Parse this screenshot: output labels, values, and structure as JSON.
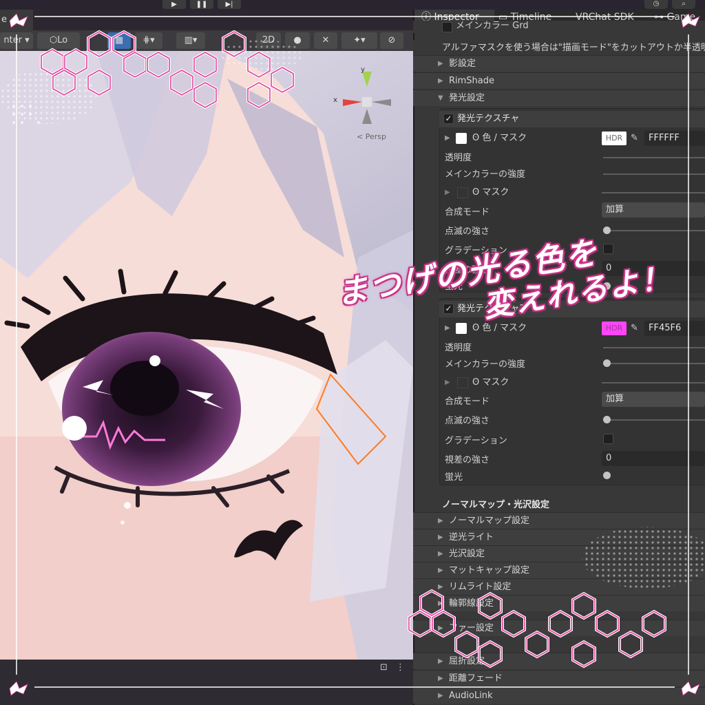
{
  "playbar": {
    "play_icon": "play-icon",
    "pause_icon": "pause-icon",
    "step_icon": "step-icon",
    "history_icon": "history-icon",
    "search_icon": "search-icon"
  },
  "scene": {
    "tab_label": "e",
    "toolbar": {
      "pivot_label": "nter",
      "local_label": "Lo",
      "mode_2d": "2D"
    },
    "gizmo": {
      "y_label": "y",
      "x_label": "x",
      "persp_label": "< Persp"
    }
  },
  "inspector": {
    "tabs": [
      "Inspector",
      "Timeline",
      "VRChat SDK",
      "Game"
    ],
    "top_cut_label": "メインカラー Grd",
    "alpha_note": "アルファマスクを使う場合は\"描画モード\"をカットアウトか半透明に変更",
    "foldouts_top": [
      "影設定",
      "RimShade",
      "発光設定"
    ],
    "emission1": {
      "title": "発光テクスチャ",
      "color_label": "色 / マスク",
      "hdr": "HDR",
      "hex": "FFFFFF",
      "props": [
        "透明度",
        "メインカラーの強度"
      ],
      "mask_label": "マスク",
      "blend_label": "合成モード",
      "blend_value": "加算",
      "blink_label": "点滅の強さ",
      "gradient_label": "グラデーション",
      "parallax_label": "視差の強さ",
      "parallax_value": "0",
      "fluor_label": "蛍光"
    },
    "emission2": {
      "title": "発光テクスチャ2",
      "color_label": "色 / マスク",
      "hdr": "HDR",
      "hex": "FF45F6",
      "props": [
        "透明度",
        "メインカラーの強度"
      ],
      "mask_label": "マスク",
      "blend_label": "合成モード",
      "blend_value": "加算",
      "blink_label": "点滅の強さ",
      "gradient_label": "グラデーション",
      "parallax_label": "視差の強さ",
      "parallax_value": "0",
      "fluor_label": "蛍光"
    },
    "normal_section_title": "ノーマルマップ・光沢設定",
    "foldouts_bottom": [
      "ノーマルマップ設定",
      "逆光ライト",
      "光沢設定",
      "マットキャップ設定",
      "リムライト設定",
      "輪郭線設定",
      "ファー設定",
      "屈折設定",
      "距離フェード",
      "AudioLink"
    ]
  },
  "overlay": {
    "caption_line1": "まつげの光る色を",
    "caption_line2": "変えれるよ！"
  },
  "colors": {
    "accent_pink": "#d63c98",
    "emission2_color": "#ff45f6",
    "inspector_bg": "#383838"
  }
}
